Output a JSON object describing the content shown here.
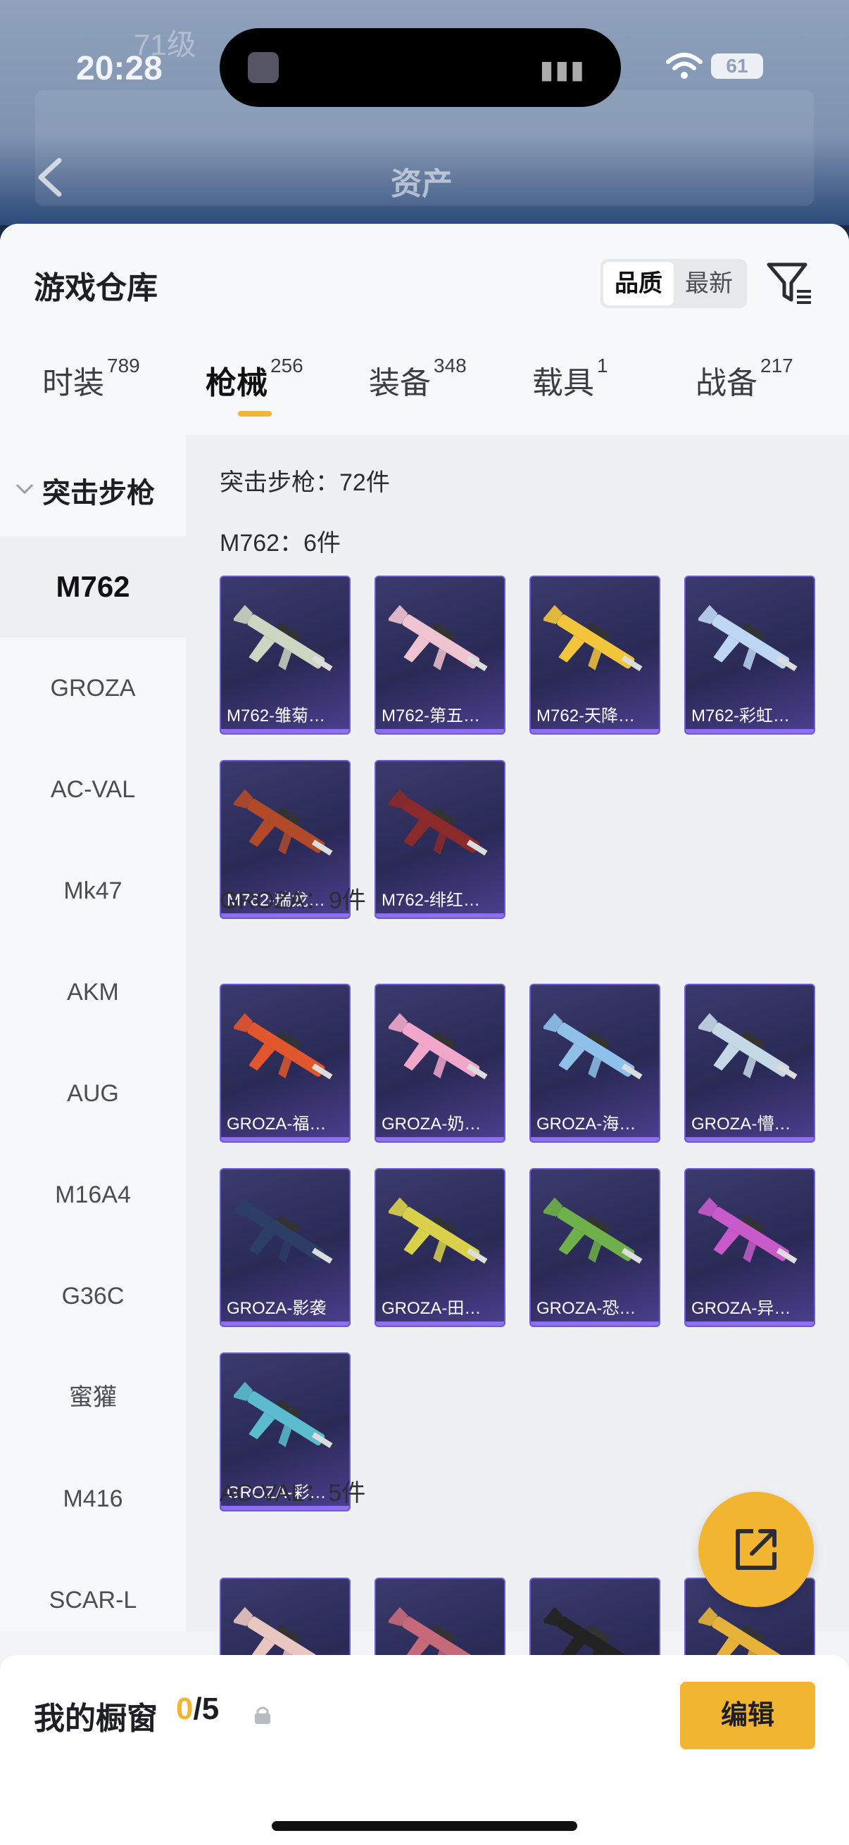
{
  "status": {
    "time": "20:28",
    "battery": "61"
  },
  "header": {
    "title": "资产",
    "level": "71级"
  },
  "sheet": {
    "title": "游戏仓库"
  },
  "sort": {
    "quality": "品质",
    "latest": "最新"
  },
  "tabs": [
    {
      "label": "时装",
      "count": "789"
    },
    {
      "label": "枪械",
      "count": "256"
    },
    {
      "label": "装备",
      "count": "348"
    },
    {
      "label": "载具",
      "count": "1"
    },
    {
      "label": "战备",
      "count": "217"
    }
  ],
  "sidebar": {
    "category": "突击步枪",
    "items": [
      "M762",
      "GROZA",
      "AC-VAL",
      "Mk47",
      "AKM",
      "AUG",
      "M16A4",
      "G36C",
      "蜜獾",
      "M416",
      "SCAR-L"
    ]
  },
  "content": {
    "summary": "突击步枪：72件",
    "groups": [
      {
        "label": "M762：6件",
        "items": [
          "M762-雏菊…",
          "M762-第五…",
          "M762-天降…",
          "M762-彩虹…",
          "M762-瑞龙…",
          "M762-绯红…"
        ]
      },
      {
        "label": "GROZA：9件",
        "items": [
          "GROZA-福…",
          "GROZA-奶…",
          "GROZA-海…",
          "GROZA-懵…",
          "GROZA-影袭",
          "GROZA-田…",
          "GROZA-恐…",
          "GROZA-异…",
          "GROZA-彩…"
        ]
      },
      {
        "label": "AC-VAL：5件",
        "items": [
          "",
          "",
          "",
          ""
        ]
      }
    ]
  },
  "gun_colors": {
    "m762": [
      "#cdd6c0",
      "#f0c3d0",
      "#f2c53a",
      "#bcd6f3",
      "#b24a2a",
      "#8a2a2a"
    ],
    "groza": [
      "#e2562d",
      "#f1a7c9",
      "#8fc0ea",
      "#c4d8e6",
      "#2c3d66",
      "#d9d14a",
      "#6fb04a",
      "#c85ac9",
      "#5bbccd"
    ],
    "acval": [
      "#e9c6c0",
      "#c66a7a",
      "#222222",
      "#e6b23a"
    ]
  },
  "bottom": {
    "showcase_label": "我的橱窗",
    "current": "0",
    "total": "/5",
    "edit": "编辑"
  }
}
